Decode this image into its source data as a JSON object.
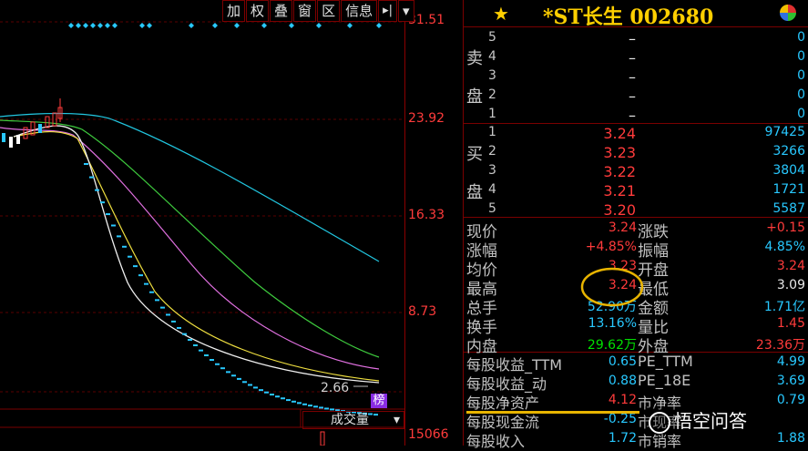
{
  "toolbar": {
    "buttons": [
      "加",
      "权",
      "叠",
      "窗",
      "区",
      "信息"
    ],
    "arrow_right": "▸|",
    "dropdown": "▾"
  },
  "chart": {
    "y_ticks": [
      "31.51",
      "23.92",
      "16.33",
      "8.73"
    ],
    "price_label": "2.66",
    "badge": "榜",
    "volume_selector": "成交量",
    "volume_tick": "15066",
    "colors": {
      "ma_cyan": "#21c6e0",
      "ma_green": "#3ecb3e",
      "ma_pink": "#e070e0",
      "ma_white": "#f0f0f0",
      "ma_yellow": "#f0e040",
      "dashes": "#28c8ff"
    }
  },
  "panel": {
    "star_icon": "star-icon",
    "stock_title": "*ST长生 002680",
    "sell_side_label": [
      "卖",
      "盘"
    ],
    "buy_side_label": [
      "买",
      "盘"
    ],
    "sell": [
      {
        "level": "5",
        "price": "–",
        "volume": "0"
      },
      {
        "level": "4",
        "price": "–",
        "volume": "0"
      },
      {
        "level": "3",
        "price": "–",
        "volume": "0"
      },
      {
        "level": "2",
        "price": "–",
        "volume": "0"
      },
      {
        "level": "1",
        "price": "–",
        "volume": "0"
      }
    ],
    "buy": [
      {
        "level": "1",
        "price": "3.24",
        "volume": "97425"
      },
      {
        "level": "2",
        "price": "3.23",
        "volume": "3266"
      },
      {
        "level": "3",
        "price": "3.22",
        "volume": "3804"
      },
      {
        "level": "4",
        "price": "3.21",
        "volume": "1721"
      },
      {
        "level": "5",
        "price": "3.20",
        "volume": "5587"
      }
    ],
    "stats": [
      {
        "l1": "现价",
        "v1": "3.24",
        "c1": "red",
        "l2": "涨跌",
        "v2": "+0.15",
        "c2": "red"
      },
      {
        "l1": "涨幅",
        "v1": "+4.85%",
        "c1": "red",
        "l2": "振幅",
        "v2": "4.85%",
        "c2": "cyan"
      },
      {
        "l1": "均价",
        "v1": "3.23",
        "c1": "red",
        "l2": "开盘",
        "v2": "3.24",
        "c2": "red"
      },
      {
        "l1": "最高",
        "v1": "3.24",
        "c1": "red",
        "l2": "最低",
        "v2": "3.09",
        "c2": "white"
      },
      {
        "l1": "总手",
        "v1": "52.90万",
        "c1": "cyan",
        "l2": "金额",
        "v2": "1.71亿",
        "c2": "cyan"
      },
      {
        "l1": "换手",
        "v1": "13.16%",
        "c1": "cyan",
        "l2": "量比",
        "v2": "1.45",
        "c2": "red"
      },
      {
        "l1": "内盘",
        "v1": "29.62万",
        "c1": "green",
        "l2": "外盘",
        "v2": "23.36万",
        "c2": "red"
      }
    ],
    "fin": [
      {
        "l1": "每股收益_TTM",
        "v1": "0.65",
        "c1": "cyan",
        "l2": "PE_TTM",
        "v2": "4.99",
        "c2": "cyan"
      },
      {
        "l1": "每股收益_动",
        "v1": "0.88",
        "c1": "cyan",
        "l2": "PE_18E",
        "v2": "3.69",
        "c2": "cyan"
      },
      {
        "l1": "每股净资产",
        "v1": "4.12",
        "c1": "red",
        "l2": "市净率",
        "v2": "0.79",
        "c2": "cyan"
      },
      {
        "l1": "每股现金流",
        "v1": "-0.25",
        "c1": "cyan",
        "l2": "市现率",
        "v2": "",
        "c2": "cyan"
      },
      {
        "l1": "每股收入",
        "v1": "1.72",
        "c1": "cyan",
        "l2": "市销率",
        "v2": "1.88",
        "c2": "cyan"
      }
    ],
    "watermark": "悟空问答"
  }
}
